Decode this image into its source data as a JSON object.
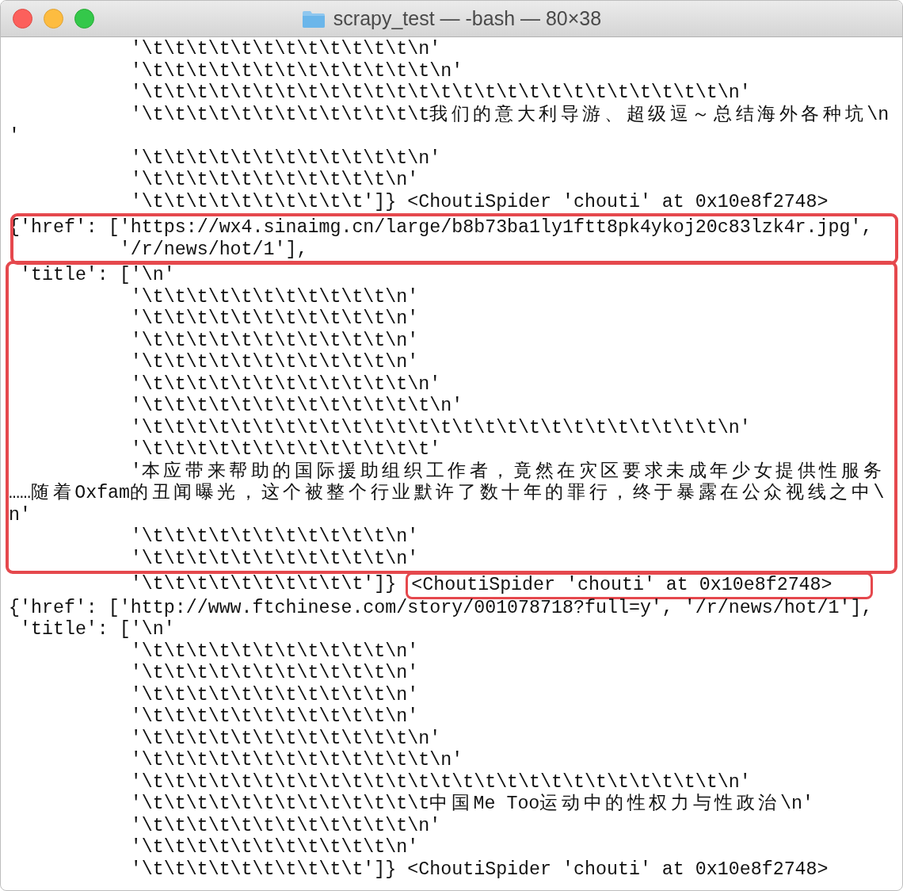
{
  "window": {
    "title": "scrapy_test — -bash — 80×38"
  },
  "blocks": [
    {
      "highlighted": false,
      "lines": [
        {
          "text": "           '\\t\\t\\t\\t\\t\\t\\t\\t\\t\\t\\t\\t\\n'"
        },
        {
          "text": "           '\\t\\t\\t\\t\\t\\t\\t\\t\\t\\t\\t\\t\\t\\n'"
        },
        {
          "text": "           '\\t\\t\\t\\t\\t\\t\\t\\t\\t\\t\\t\\t\\t\\t\\t\\t\\t\\t\\t\\t\\t\\t\\t\\t\\t\\t\\n'"
        },
        {
          "text": "           '\\t\\t\\t\\t\\t\\t\\t\\t\\t\\t\\t\\t\\t我们的意大利导游、超级逗～总结海外各种坑\\n"
        },
        {
          "text": "'"
        },
        {
          "text": "           '\\t\\t\\t\\t\\t\\t\\t\\t\\t\\t\\t\\t\\n'"
        },
        {
          "text": "           '\\t\\t\\t\\t\\t\\t\\t\\t\\t\\t\\t\\n'"
        },
        {
          "text": "           '\\t\\t\\t\\t\\t\\t\\t\\t\\t\\t']} <ChoutiSpider 'chouti' at 0x10e8f2748>"
        }
      ]
    },
    {
      "highlighted": true,
      "lines": [
        {
          "text": "{'href': ['https://wx4.sinaimg.cn/large/b8b73ba1ly1ftt8pk4ykoj20c83lzk4r.jpg',"
        },
        {
          "text": "          '/r/news/hot/1'],"
        }
      ]
    },
    {
      "highlighted": true,
      "lines": [
        {
          "text": " 'title': ['\\n'"
        },
        {
          "text": "           '\\t\\t\\t\\t\\t\\t\\t\\t\\t\\t\\t\\n'"
        },
        {
          "text": "           '\\t\\t\\t\\t\\t\\t\\t\\t\\t\\t\\t\\n'"
        },
        {
          "text": "           '\\t\\t\\t\\t\\t\\t\\t\\t\\t\\t\\t\\n'"
        },
        {
          "text": "           '\\t\\t\\t\\t\\t\\t\\t\\t\\t\\t\\t\\n'"
        },
        {
          "text": "           '\\t\\t\\t\\t\\t\\t\\t\\t\\t\\t\\t\\t\\n'"
        },
        {
          "text": "           '\\t\\t\\t\\t\\t\\t\\t\\t\\t\\t\\t\\t\\t\\n'"
        },
        {
          "text": "           '\\t\\t\\t\\t\\t\\t\\t\\t\\t\\t\\t\\t\\t\\t\\t\\t\\t\\t\\t\\t\\t\\t\\t\\t\\t\\t\\n'"
        },
        {
          "text": "           '\\t\\t\\t\\t\\t\\t\\t\\t\\t\\t\\t\\t\\t'"
        },
        {
          "text": "           '本应带来帮助的国际援助组织工作者，竟然在灾区要求未成年少女提供性服务"
        },
        {
          "text": "……随着Oxfam的丑闻曝光，这个被整个行业默许了数十年的罪行，终于暴露在公众视线之中\\"
        },
        {
          "text": "n'"
        },
        {
          "text": "           '\\t\\t\\t\\t\\t\\t\\t\\t\\t\\t\\t\\n'"
        },
        {
          "text": "           '\\t\\t\\t\\t\\t\\t\\t\\t\\t\\t\\t\\n'"
        }
      ]
    },
    {
      "highlighted": false,
      "lines": [
        {
          "text": "           '\\t\\t\\t\\t\\t\\t\\t\\t\\t\\t']} ",
          "boxed": "<ChoutiSpider 'chouti' at 0x10e8f2748>"
        },
        {
          "text": "{'href': ['http://www.ftchinese.com/story/001078718?full=y', '/r/news/hot/1'],"
        },
        {
          "text": " 'title': ['\\n'"
        },
        {
          "text": "           '\\t\\t\\t\\t\\t\\t\\t\\t\\t\\t\\t\\n'"
        },
        {
          "text": "           '\\t\\t\\t\\t\\t\\t\\t\\t\\t\\t\\t\\n'"
        },
        {
          "text": "           '\\t\\t\\t\\t\\t\\t\\t\\t\\t\\t\\t\\n'"
        },
        {
          "text": "           '\\t\\t\\t\\t\\t\\t\\t\\t\\t\\t\\t\\n'"
        },
        {
          "text": "           '\\t\\t\\t\\t\\t\\t\\t\\t\\t\\t\\t\\t\\n'"
        },
        {
          "text": "           '\\t\\t\\t\\t\\t\\t\\t\\t\\t\\t\\t\\t\\t\\n'"
        },
        {
          "text": "           '\\t\\t\\t\\t\\t\\t\\t\\t\\t\\t\\t\\t\\t\\t\\t\\t\\t\\t\\t\\t\\t\\t\\t\\t\\t\\t\\n'"
        },
        {
          "text": "           '\\t\\t\\t\\t\\t\\t\\t\\t\\t\\t\\t\\t\\t中国Me Too运动中的性权力与性政治\\n'"
        },
        {
          "text": "           '\\t\\t\\t\\t\\t\\t\\t\\t\\t\\t\\t\\t\\n'"
        },
        {
          "text": "           '\\t\\t\\t\\t\\t\\t\\t\\t\\t\\t\\t\\n'"
        },
        {
          "text": "           '\\t\\t\\t\\t\\t\\t\\t\\t\\t\\t']} <ChoutiSpider 'chouti' at 0x10e8f2748>"
        }
      ]
    }
  ]
}
